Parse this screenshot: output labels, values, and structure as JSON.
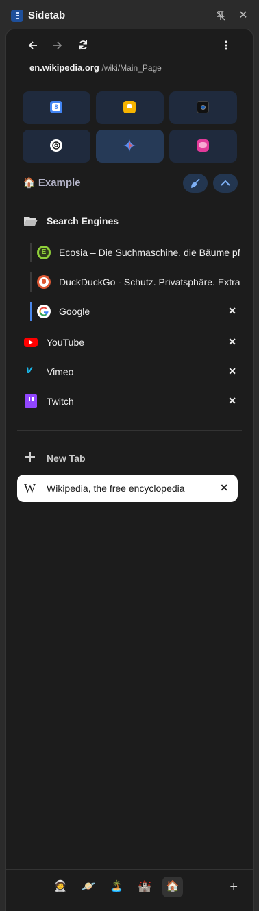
{
  "app": {
    "title": "Sidetab"
  },
  "titlebar": {
    "unpin_icon": "unpin-icon",
    "close_icon": "close-icon"
  },
  "nav": {
    "back": "back-arrow-icon",
    "forward": "forward-arrow-icon",
    "reload": "reload-icon",
    "more": "more-vertical-icon"
  },
  "url": {
    "host": "en.wikipedia.org",
    "path": "/wiki/Main_Page"
  },
  "favorites": [
    {
      "name": "google-calendar",
      "color": "#4285f4"
    },
    {
      "name": "google-keep",
      "color": "#f6b400"
    },
    {
      "name": "camera-app",
      "color": "#2b2b2b"
    },
    {
      "name": "chatgpt",
      "color": "#ffffff"
    },
    {
      "name": "gemini",
      "color": "#4a86e8"
    },
    {
      "name": "chat-app",
      "color": "#e23a9a"
    }
  ],
  "space": {
    "emoji": "🏠",
    "title": "Example",
    "clean_icon": "broom-icon",
    "collapse_icon": "chevron-up-icon"
  },
  "folder": {
    "title": "Search Engines"
  },
  "folder_items": [
    {
      "label": "Ecosia – Die Suchmaschine, die Bäume pfl",
      "color": "#8fcf3a",
      "glyph": "E"
    },
    {
      "label": "DuckDuckGo - Schutz. Privatsphäre. Extra",
      "color": "#de5833",
      "glyph": "D"
    },
    {
      "label": "Google",
      "color": "#ffffff",
      "glyph": "G",
      "closable": true
    }
  ],
  "pinned": [
    {
      "label": "YouTube",
      "color": "#ff0000",
      "glyph": "▶"
    },
    {
      "label": "Vimeo",
      "color": "#1ab7ea",
      "glyph": "v"
    },
    {
      "label": "Twitch",
      "color": "#9146ff",
      "glyph": "t"
    }
  ],
  "new_tab": {
    "label": "New Tab"
  },
  "open_tab": {
    "label": "Wikipedia, the free encyclopedia",
    "glyph": "W"
  },
  "spaces": [
    {
      "emoji": "🧑‍🚀"
    },
    {
      "emoji": "🪐"
    },
    {
      "emoji": "🏝️"
    },
    {
      "emoji": "🏰"
    },
    {
      "emoji": "🏠",
      "active": true
    }
  ],
  "add_space": "+"
}
